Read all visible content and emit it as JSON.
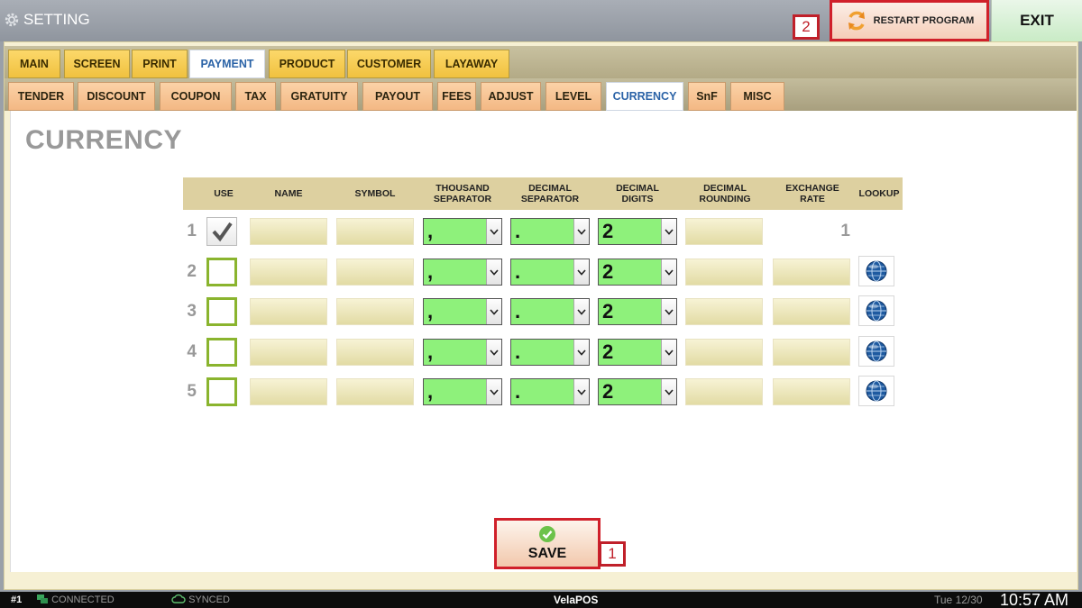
{
  "window": {
    "title": "SETTING"
  },
  "toolbar": {
    "restart_label": "RESTART PROGRAM",
    "exit_label": "EXIT"
  },
  "callouts": {
    "save": "1",
    "restart": "2"
  },
  "main_tabs": [
    "MAIN",
    "SCREEN",
    "PRINT",
    "PAYMENT",
    "PRODUCT",
    "CUSTOMER",
    "LAYAWAY"
  ],
  "main_tabs_active": "PAYMENT",
  "sub_tabs": [
    "TENDER",
    "DISCOUNT",
    "COUPON",
    "TAX",
    "GRATUITY",
    "PAYOUT",
    "FEES",
    "ADJUST",
    "LEVEL",
    "CURRENCY",
    "SnF",
    "MISC"
  ],
  "sub_tabs_active": "CURRENCY",
  "page": {
    "title": "CURRENCY"
  },
  "columns": {
    "use": "USE",
    "name": "NAME",
    "symbol": "SYMBOL",
    "thousand": [
      "THOUSAND",
      "SEPARATOR"
    ],
    "decimal_sep": [
      "DECIMAL",
      "SEPARATOR"
    ],
    "decimal_digits": [
      "DECIMAL",
      "DIGITS"
    ],
    "decimal_rounding": [
      "DECIMAL",
      "ROUNDING"
    ],
    "exchange_rate": [
      "EXCHANGE",
      "RATE"
    ],
    "lookup": "LOOKUP"
  },
  "rows": [
    {
      "num": "1",
      "use": true,
      "name": "",
      "symbol": "",
      "thousand": ",",
      "decimal": ".",
      "digits": "2",
      "rounding": "",
      "rate": "1",
      "lookup": false
    },
    {
      "num": "2",
      "use": false,
      "name": "",
      "symbol": "",
      "thousand": ",",
      "decimal": ".",
      "digits": "2",
      "rounding": "",
      "rate": "",
      "lookup": true
    },
    {
      "num": "3",
      "use": false,
      "name": "",
      "symbol": "",
      "thousand": ",",
      "decimal": ".",
      "digits": "2",
      "rounding": "",
      "rate": "",
      "lookup": true
    },
    {
      "num": "4",
      "use": false,
      "name": "",
      "symbol": "",
      "thousand": ",",
      "decimal": ".",
      "digits": "2",
      "rounding": "",
      "rate": "",
      "lookup": true
    },
    {
      "num": "5",
      "use": false,
      "name": "",
      "symbol": "",
      "thousand": ",",
      "decimal": ".",
      "digits": "2",
      "rounding": "",
      "rate": "",
      "lookup": true
    }
  ],
  "save": {
    "label": "SAVE"
  },
  "status": {
    "station": "#1",
    "connection": "CONNECTED",
    "sync": "SYNCED",
    "app": "VelaPOS",
    "date": "Tue 12/30",
    "time": "10:57 AM"
  },
  "colors": {
    "accent_red": "#d0202a",
    "select_green": "#8ef17b",
    "tab_yellow": "#f0c13f",
    "subtab_peach": "#f3b884"
  }
}
